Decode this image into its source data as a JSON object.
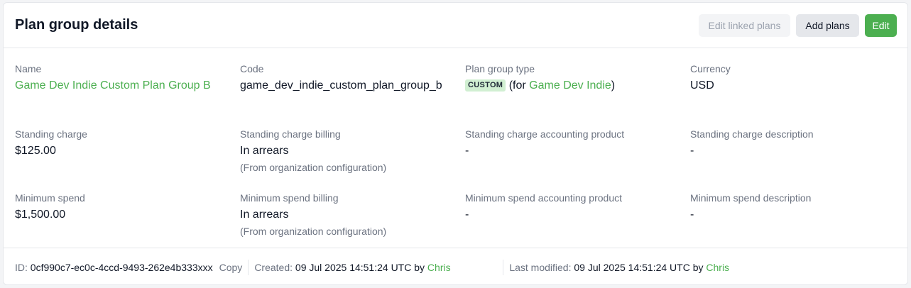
{
  "header": {
    "title": "Plan group details",
    "edit_linked_label": "Edit linked plans",
    "add_plans_label": "Add plans",
    "edit_label": "Edit"
  },
  "fields": {
    "name": {
      "label": "Name",
      "value": "Game Dev Indie Custom Plan Group B"
    },
    "code": {
      "label": "Code",
      "value": "game_dev_indie_custom_plan_group_b"
    },
    "type": {
      "label": "Plan group type",
      "badge": "CUSTOM",
      "for_prefix": "(for ",
      "for_link": "Game Dev Indie",
      "for_suffix": ")"
    },
    "currency": {
      "label": "Currency",
      "value": "USD"
    },
    "standing_charge": {
      "label": "Standing charge",
      "value": "$125.00"
    },
    "standing_charge_billing": {
      "label": "Standing charge billing",
      "value": "In arrears",
      "note": "(From organization configuration)"
    },
    "standing_charge_product": {
      "label": "Standing charge accounting product",
      "value": "-"
    },
    "standing_charge_description": {
      "label": "Standing charge description",
      "value": "-"
    },
    "minimum_spend": {
      "label": "Minimum spend",
      "value": "$1,500.00"
    },
    "minimum_spend_billing": {
      "label": "Minimum spend billing",
      "value": "In arrears",
      "note": "(From organization configuration)"
    },
    "minimum_spend_product": {
      "label": "Minimum spend accounting product",
      "value": "-"
    },
    "minimum_spend_description": {
      "label": "Minimum spend description",
      "value": "-"
    }
  },
  "footer": {
    "id_label": "ID:",
    "id_value": "0cf990c7-ec0c-4ccd-9493-262e4b333xxx",
    "copy_label": "Copy",
    "created_label": "Created:",
    "created_value": "09 Jul 2025 14:51:24 UTC by",
    "created_by": "Chris",
    "modified_label": "Last modified:",
    "modified_value": "09 Jul 2025 14:51:24 UTC by",
    "modified_by": "Chris"
  },
  "colors": {
    "accent": "#4caf50",
    "badge_bg": "#d1efd2"
  }
}
